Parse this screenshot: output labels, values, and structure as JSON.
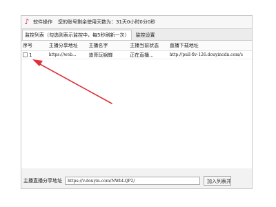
{
  "titlebar": {
    "logo_icon": "douyin-logo-icon",
    "menu_label": "软件操作",
    "status_text": "您的账号剩余使用天数为：31天0小时0分0秒"
  },
  "tabs": [
    {
      "label": "监控列表（勾选则表示监控中，每5秒刷新一次）",
      "active": true
    },
    {
      "label": "监控设置",
      "active": false
    }
  ],
  "table": {
    "columns": [
      "序号",
      "主播分享地址",
      "主播名字",
      "主播当前状态",
      "直播下载地址"
    ],
    "rows": [
      {
        "index": "1",
        "share_url": "https://web...",
        "name": "迪哥玩锅蝉",
        "status": "正在直播...",
        "download_url": "http://pull-flv-126.douyincdn.com/s"
      }
    ]
  },
  "bottom": {
    "share_label": "主播直播分享地址",
    "share_value": "https://v.douyin.com/NWbLQP2/",
    "add_button": "加入列表并开"
  },
  "annotation": {
    "arrow_color": "#e0303a"
  }
}
